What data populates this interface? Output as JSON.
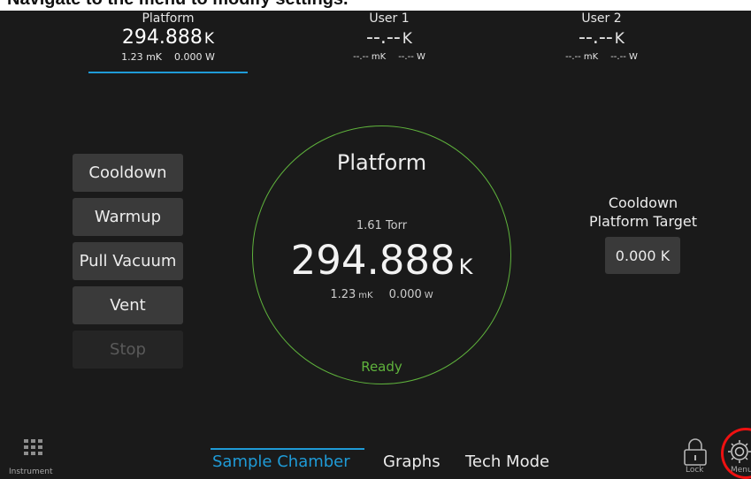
{
  "header_banner": "Navigate to the menu to modify settings.",
  "sensors": [
    {
      "name": "Platform",
      "temp": "294.888",
      "unit": "K",
      "sub1": "1.23 mK",
      "sub2": "0.000 W"
    },
    {
      "name": "User 1",
      "temp": "--.--",
      "unit": "K",
      "sub1": "--.-- mK",
      "sub2": "--.-- W"
    },
    {
      "name": "User 2",
      "temp": "--.--",
      "unit": "K",
      "sub1": "--.-- mK",
      "sub2": "--.-- W"
    }
  ],
  "actions": {
    "cooldown": "Cooldown",
    "warmup": "Warmup",
    "pull_vacuum": "Pull Vacuum",
    "vent": "Vent",
    "stop": "Stop"
  },
  "gauge": {
    "title": "Platform",
    "pressure": "1.61 Torr",
    "temp": "294.888",
    "unit": "K",
    "stability_value": "1.23",
    "stability_unit": "mK",
    "power_value": "0.000",
    "power_unit": "W",
    "status": "Ready",
    "ring_color": "#5fb33c"
  },
  "target": {
    "line1": "Cooldown",
    "line2": "Platform Target",
    "value": "0.000 K"
  },
  "bottom": {
    "instrument": "Instrument",
    "tabs": [
      "Sample Chamber",
      "Graphs",
      "Tech Mode"
    ],
    "lock": "Lock",
    "menu": "Menu"
  },
  "colors": {
    "accent": "#1f9bd7",
    "ok": "#5fb33c",
    "highlight": "#ee1111",
    "background": "#1a1a1a",
    "button": "#3a3a3a"
  }
}
